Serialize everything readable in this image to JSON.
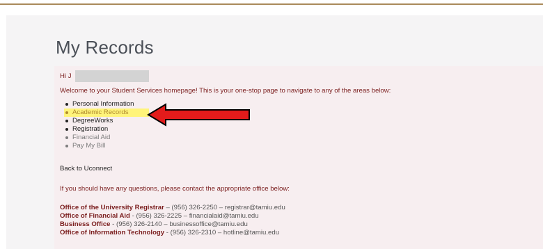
{
  "page": {
    "title": "My Records"
  },
  "panel": {
    "greeting": "Hi J",
    "welcome": "Welcome to your Student Services homepage! This is your one-stop page to navigate to any of the areas below:",
    "links": [
      {
        "label": "Personal Information",
        "style": "strong"
      },
      {
        "label": "Academic Records",
        "style": "active"
      },
      {
        "label": "DegreeWorks",
        "style": "strong"
      },
      {
        "label": "Registration",
        "style": "strong"
      },
      {
        "label": "Financial Aid",
        "style": "muted"
      },
      {
        "label": "Pay My Bill",
        "style": "muted"
      }
    ],
    "back_link": "Back to Uconnect",
    "contact_intro": "If you should have any questions, please contact the appropriate office below:",
    "offices": [
      {
        "name": "Office of the University Registrar",
        "details": " – (956) 326-2250 – registrar@tamiu.edu"
      },
      {
        "name": "Office of Financial Aid",
        "details": " - (956) 326-2225 – financialaid@tamiu.edu"
      },
      {
        "name": "Business Office",
        "details": " - (956) 326-2140 – businessoffice@tamiu.edu"
      },
      {
        "name": "Office of Information Technology",
        "details": " - (956) 326-2310 – hotline@tamiu.edu"
      }
    ]
  },
  "annotation": {
    "arrow_color": "#e31b1b",
    "highlight_color": "#fff47a",
    "arrow_icon": "left-arrow-icon"
  }
}
